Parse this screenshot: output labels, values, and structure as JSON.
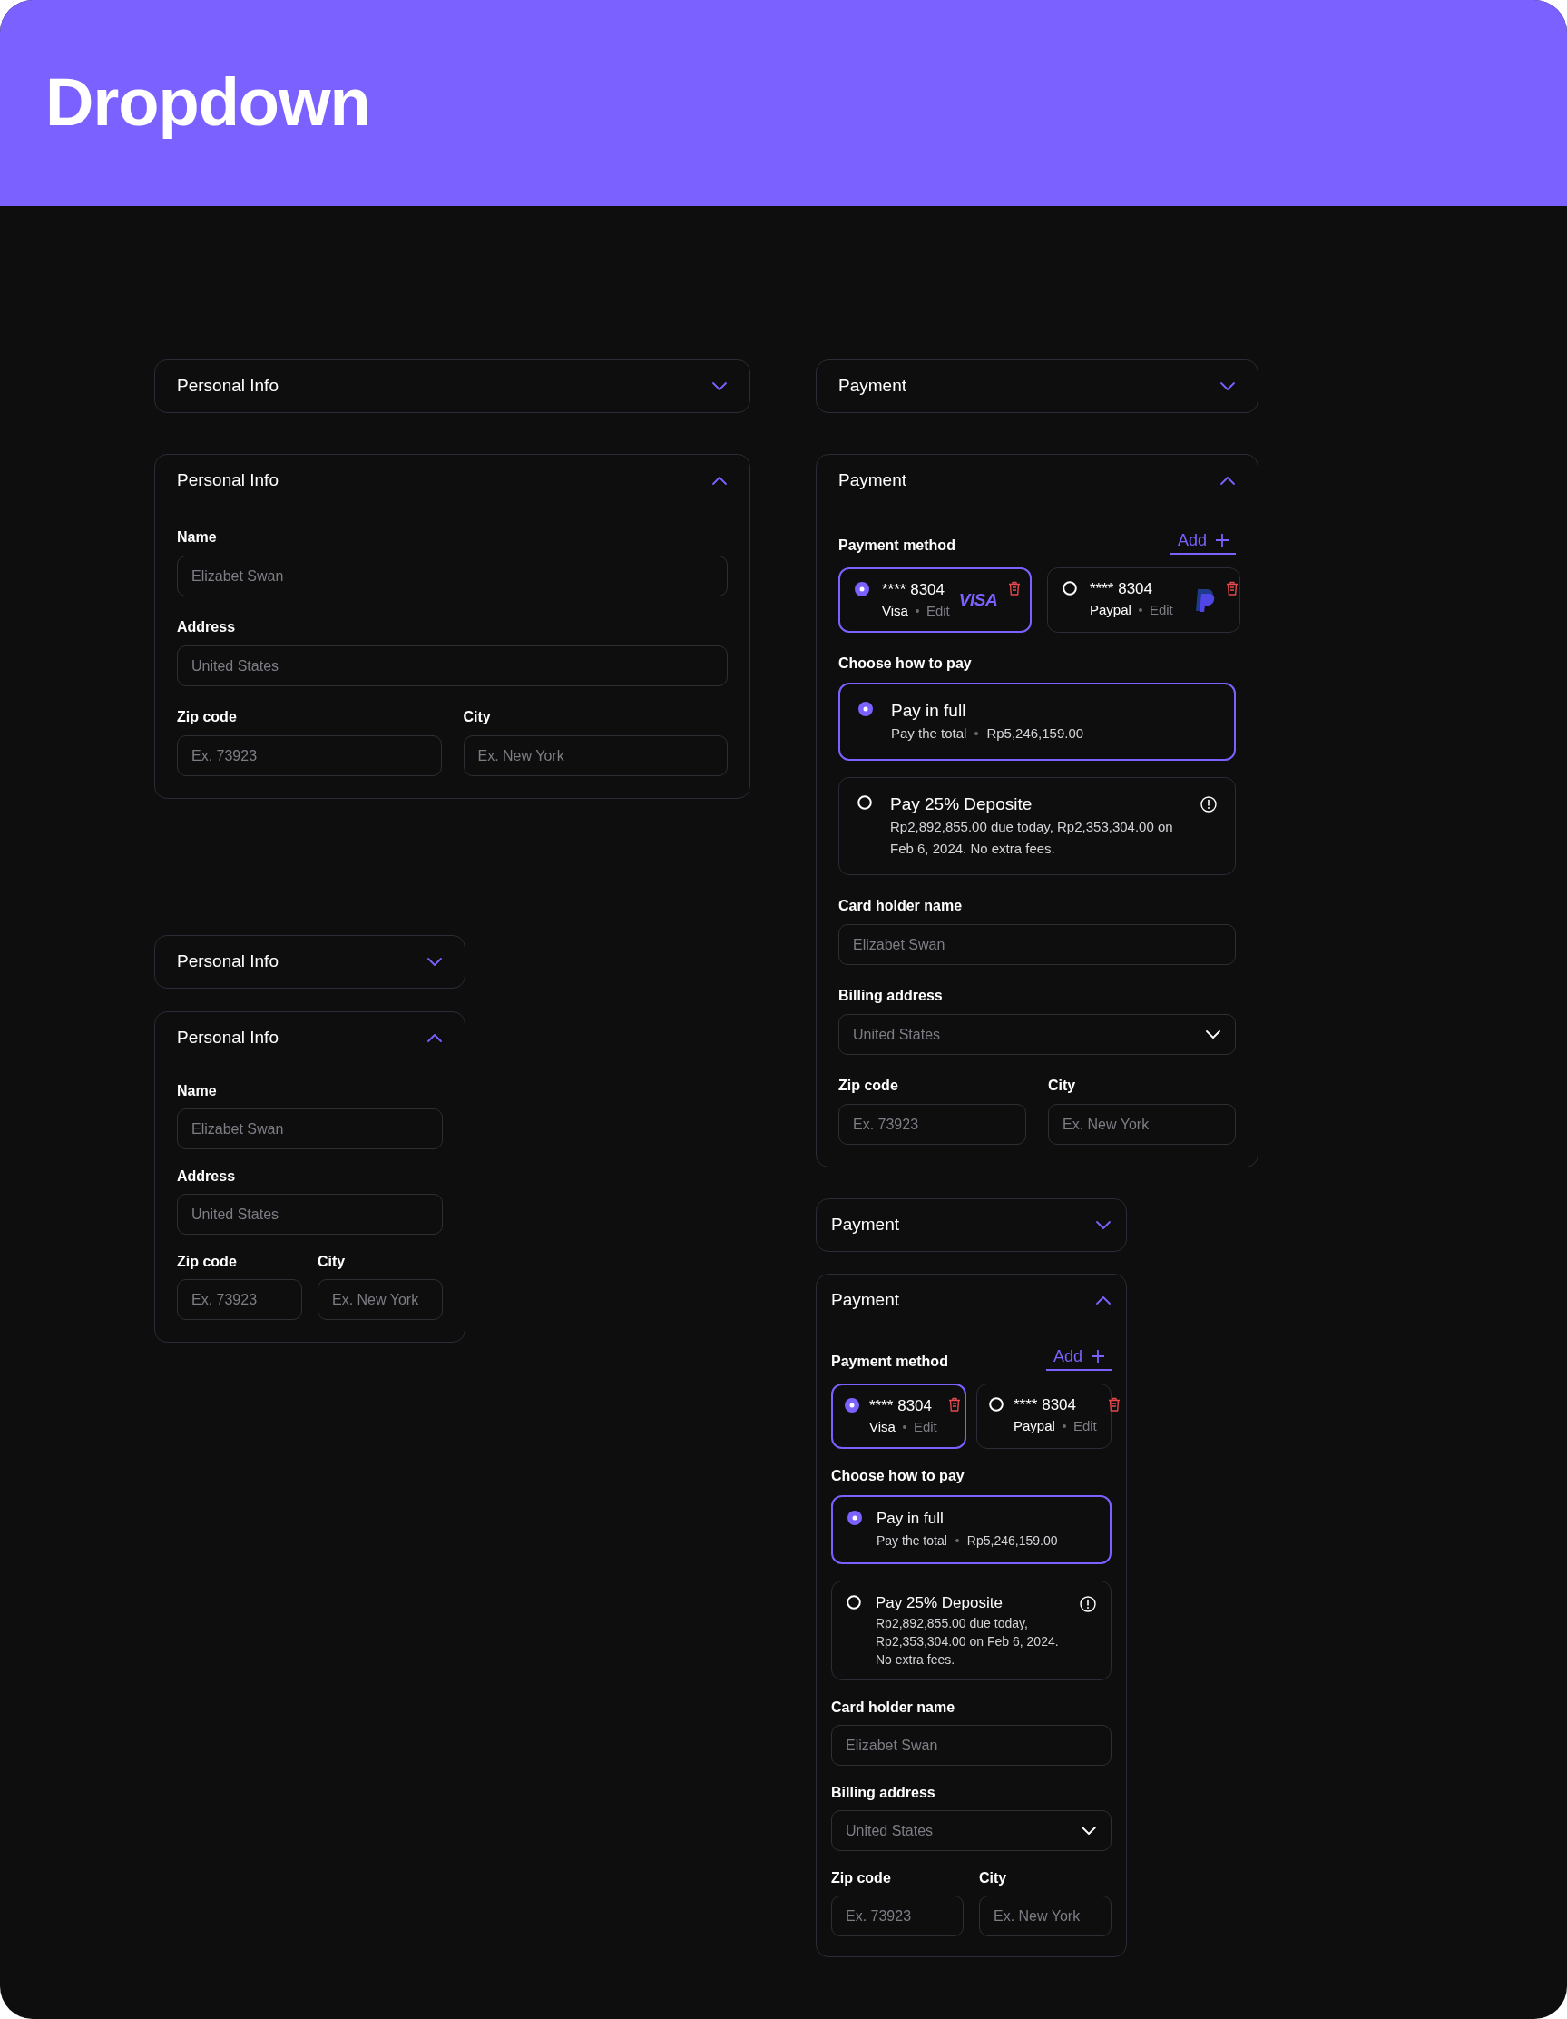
{
  "header": {
    "title": "Dropdown"
  },
  "columns": [
    {
      "panels": [
        {
          "kind": "personal",
          "title": "Personal Info",
          "expanded": false,
          "compact": false
        },
        {
          "kind": "personal",
          "title": "Personal Info",
          "expanded": true,
          "compact": false,
          "rows": [
            [
              {
                "kind": "input",
                "label": "Name",
                "placeholder": "Elizabet Swan"
              }
            ],
            [
              {
                "kind": "input",
                "label": "Address",
                "placeholder": "United States"
              }
            ],
            [
              {
                "kind": "input",
                "label": "Zip code",
                "placeholder": "Ex. 73923"
              },
              {
                "kind": "input",
                "label": "City",
                "placeholder": "Ex. New York"
              }
            ]
          ]
        },
        {
          "kind": "personal",
          "title": "Personal Info",
          "expanded": false,
          "compact": true
        },
        {
          "kind": "personal",
          "title": "Personal Info",
          "expanded": true,
          "compact": true,
          "rows": [
            [
              {
                "kind": "input",
                "label": "Name",
                "placeholder": "Elizabet Swan"
              }
            ],
            [
              {
                "kind": "input",
                "label": "Address",
                "placeholder": "United States"
              }
            ],
            [
              {
                "kind": "input",
                "label": "Zip code",
                "placeholder": "Ex. 73923"
              },
              {
                "kind": "input",
                "label": "City",
                "placeholder": "Ex. New York"
              }
            ]
          ]
        }
      ]
    },
    {
      "panels": [
        {
          "kind": "payment",
          "title": "Payment",
          "expanded": false,
          "compact": false
        },
        {
          "kind": "payment",
          "title": "Payment",
          "expanded": true,
          "compact": false,
          "method_label": "Payment method",
          "add_label": "Add",
          "methods": [
            {
              "kind": "visa",
              "number": "**** 8304",
              "type": "Visa",
              "edit": "Edit",
              "selected": true,
              "logo_text": "VISA"
            },
            {
              "kind": "paypal",
              "number": "**** 8304",
              "type": "Paypal",
              "edit": "Edit",
              "selected": false
            }
          ],
          "pay_label": "Choose how to pay",
          "options": [
            {
              "title": "Pay in full",
              "detail": "Pay the total",
              "amount": "Rp5,246,159.00",
              "selected": true
            },
            {
              "title": "Pay 25% Deposite",
              "detail": "Rp2,892,855.00 due today, Rp2,353,304.00 on Feb 6, 2024. No extra fees.",
              "selected": false,
              "info": true
            }
          ],
          "rows": [
            [
              {
                "kind": "input",
                "label": "Card holder name",
                "placeholder": "Elizabet Swan"
              }
            ],
            [
              {
                "kind": "select",
                "label": "Billing address",
                "placeholder": "United States"
              }
            ],
            [
              {
                "kind": "input",
                "label": "Zip code",
                "placeholder": "Ex. 73923"
              },
              {
                "kind": "input",
                "label": "City",
                "placeholder": "Ex. New York"
              }
            ]
          ]
        },
        {
          "kind": "payment",
          "title": "Payment",
          "expanded": false,
          "compact": true
        },
        {
          "kind": "payment",
          "title": "Payment",
          "expanded": true,
          "compact": true,
          "method_label": "Payment method",
          "add_label": "Add",
          "methods": [
            {
              "number": "**** 8304",
              "type": "Visa",
              "edit": "Edit",
              "selected": true
            },
            {
              "number": "**** 8304",
              "type": "Paypal",
              "edit": "Edit",
              "selected": false
            }
          ],
          "pay_label": "Choose how to pay",
          "options": [
            {
              "title": "Pay in full",
              "detail": "Pay the total",
              "amount": "Rp5,246,159.00",
              "selected": true
            },
            {
              "title": "Pay 25% Deposite",
              "detail": "Rp2,892,855.00 due today, Rp2,353,304.00 on Feb 6, 2024. No extra fees.",
              "selected": false,
              "info": true
            }
          ],
          "rows": [
            [
              {
                "kind": "input",
                "label": "Card holder name",
                "placeholder": "Elizabet Swan"
              }
            ],
            [
              {
                "kind": "select",
                "label": "Billing address",
                "placeholder": "United States"
              }
            ],
            [
              {
                "kind": "input",
                "label": "Zip code",
                "placeholder": "Ex. 73923"
              },
              {
                "kind": "input",
                "label": "City",
                "placeholder": "Ex. New York"
              }
            ]
          ]
        }
      ]
    }
  ]
}
